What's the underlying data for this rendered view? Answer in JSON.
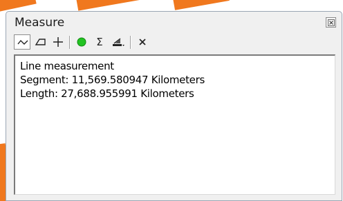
{
  "window": {
    "title": "Measure"
  },
  "toolbar": {
    "tools": [
      {
        "name": "measure-line",
        "icon": "line-measure-icon",
        "active": true
      },
      {
        "name": "measure-area",
        "icon": "area-measure-icon",
        "active": false
      },
      {
        "name": "measure-feature",
        "icon": "feature-measure-icon",
        "active": false
      },
      {
        "name": "snap-to-features",
        "icon": "green-circle-icon",
        "active": false
      },
      {
        "name": "show-total",
        "icon": "sigma-icon",
        "active": false
      },
      {
        "name": "choose-units",
        "icon": "units-dropdown-icon",
        "active": false
      },
      {
        "name": "clear-results",
        "icon": "clear-x-icon",
        "active": false
      }
    ]
  },
  "output": {
    "lines": [
      "Line measurement",
      "Segment: 11,569.580947 Kilometers",
      "Length: 27,688.955991 Kilometers"
    ]
  },
  "colors": {
    "window_bg": "#f0f0f0",
    "snap_green": "#22c322",
    "background_accent": "#f0781e"
  }
}
